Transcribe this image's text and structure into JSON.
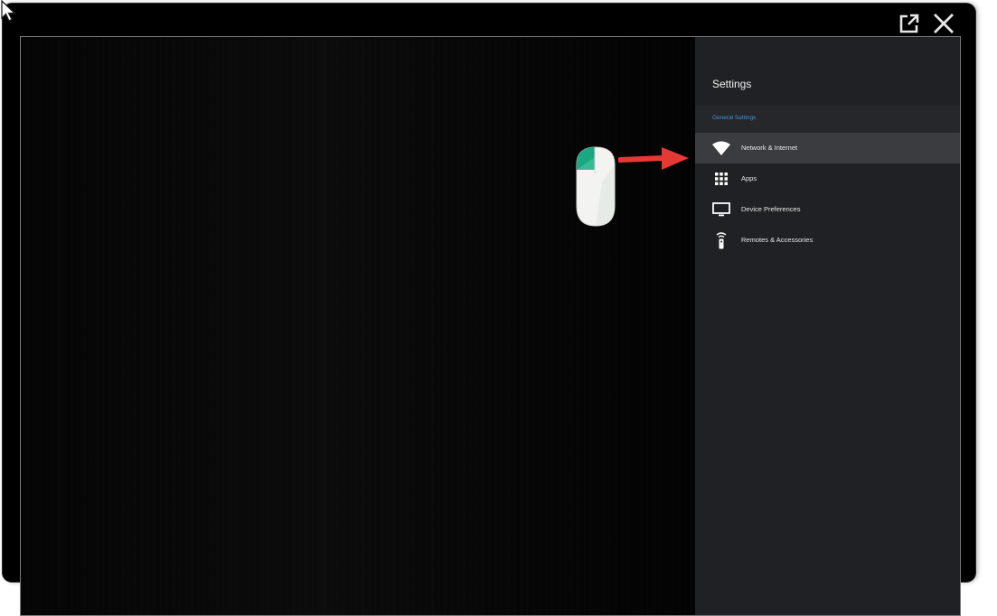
{
  "window": {
    "controls": {
      "popout_icon": "external-link-icon",
      "close_icon": "close-icon"
    }
  },
  "settings": {
    "title": "Settings",
    "section_header": "General Settings",
    "items": [
      {
        "label": "Network & Internet",
        "icon": "wifi-icon",
        "selected": true
      },
      {
        "label": "Apps",
        "icon": "apps-grid-icon",
        "selected": false
      },
      {
        "label": "Device Preferences",
        "icon": "tv-icon",
        "selected": false
      },
      {
        "label": "Remotes & Accessories",
        "icon": "remote-icon",
        "selected": false
      }
    ]
  },
  "colors": {
    "panel_background": "#202124",
    "selected_item": "#3b3c40",
    "section_header_text": "#4a90d9",
    "arrow": "#e53935",
    "mouse_accent": "#1aa782"
  }
}
